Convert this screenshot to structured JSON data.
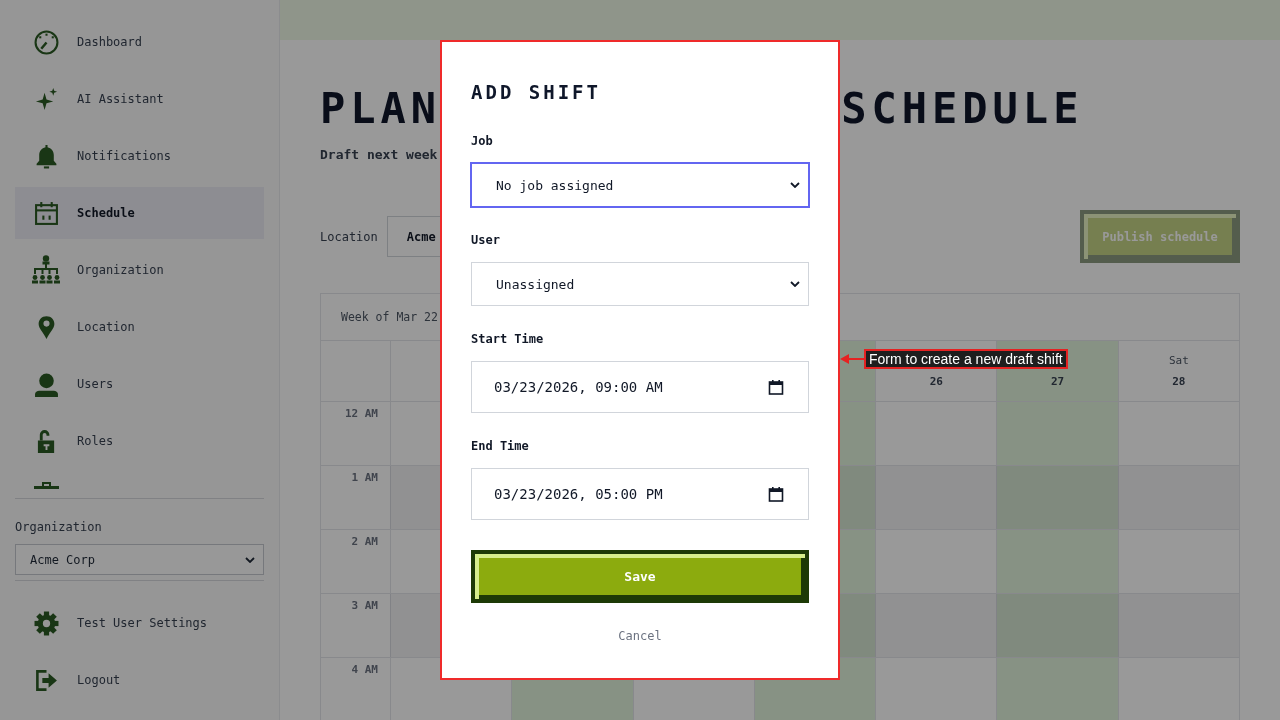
{
  "sidebar": {
    "items": [
      {
        "label": "Dashboard",
        "selected": false
      },
      {
        "label": "AI Assistant",
        "selected": false
      },
      {
        "label": "Notifications",
        "selected": false
      },
      {
        "label": "Schedule",
        "selected": true
      },
      {
        "label": "Organization",
        "selected": false
      },
      {
        "label": "Location",
        "selected": false
      },
      {
        "label": "Users",
        "selected": false
      },
      {
        "label": "Roles",
        "selected": false
      }
    ],
    "partly_hidden_item": true,
    "organization": {
      "label": "Organization",
      "value": "Acme Corp"
    },
    "footer_items": [
      {
        "label": "Test User Settings"
      },
      {
        "label": "Logout"
      }
    ]
  },
  "page": {
    "title_parts": [
      "PLAN",
      "SCHEDULE"
    ],
    "subtitle": "Draft next week",
    "location": {
      "label": "Location",
      "value": "Acme"
    },
    "publish_button": {
      "label": "Publish schedule",
      "disabled": true
    }
  },
  "calendar": {
    "week_label": "Week of Mar 22",
    "days": [
      {
        "highlighted": false
      },
      {
        "highlighted": true
      },
      {
        "highlighted": false
      },
      {
        "highlighted": true
      },
      {
        "date": "26",
        "highlighted": false
      },
      {
        "date": "27",
        "highlighted": true
      },
      {
        "name": "Sat",
        "date": "28",
        "highlighted": false
      }
    ],
    "hours": [
      "12 AM",
      "1 AM",
      "2 AM",
      "3 AM",
      "4 AM"
    ]
  },
  "dialog": {
    "title": "ADD SHIFT",
    "fields": [
      {
        "kind": "select",
        "label": "Job",
        "value": "No job assigned",
        "focused": true
      },
      {
        "kind": "select",
        "label": "User",
        "value": "Unassigned",
        "focused": false
      },
      {
        "kind": "datetime",
        "label": "Start Time",
        "value": "03/23/2026, 09:00 AM",
        "focused": false
      },
      {
        "kind": "datetime",
        "label": "End Time",
        "value": "03/23/2026, 05:00 PM",
        "focused": false
      }
    ],
    "save_button": "Save",
    "cancel_button": "Cancel"
  },
  "annotation": {
    "label": "Form to create a new draft shift",
    "outline": true
  }
}
